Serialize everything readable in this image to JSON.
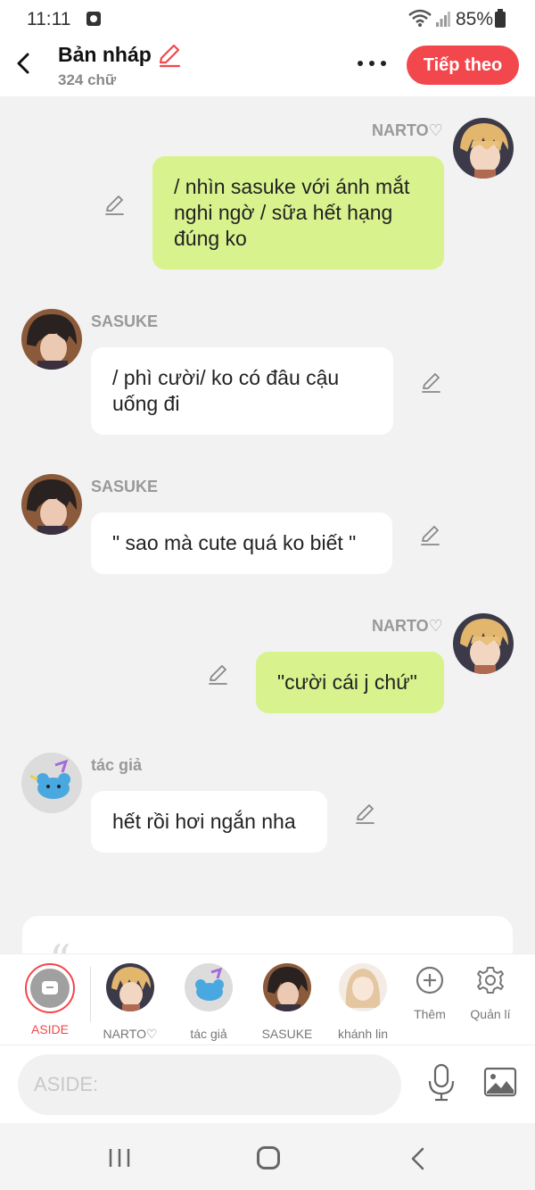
{
  "status_bar": {
    "time": "11:11",
    "battery": "85%"
  },
  "header": {
    "title": "Bản nháp",
    "word_count": "324 chữ",
    "next_label": "Tiếp theo"
  },
  "messages": [
    {
      "sender": "NARTO♡",
      "side": "right",
      "text": "/ nhìn sasuke với ánh mắt nghi ngờ / sữa hết hạng đúng ko"
    },
    {
      "sender": "SASUKE",
      "side": "left",
      "text": "/ phì cười/ ko có đâu cậu uống đi"
    },
    {
      "sender": "SASUKE",
      "side": "left",
      "text": "\" sao mà cute quá ko biết \""
    },
    {
      "sender": "NARTO♡",
      "side": "right",
      "text": "\"cười cái j chứ\""
    },
    {
      "sender": "tác giả",
      "side": "left",
      "text": "hết rồi hơi ngắn nha"
    }
  ],
  "characters": [
    {
      "label": "ASIDE",
      "active": true
    },
    {
      "label": "NARTO♡"
    },
    {
      "label": "tác giả"
    },
    {
      "label": "SASUKE"
    },
    {
      "label": "khánh lin"
    }
  ],
  "tools": {
    "add_label": "Thêm",
    "manage_label": "Quản lí"
  },
  "composer": {
    "placeholder": "ASIDE:"
  },
  "colors": {
    "accent": "#f2474c",
    "my_bubble": "#d8f38e",
    "their_bubble": "#ffffff"
  },
  "icons": [
    "back-arrow-icon",
    "pencil-icon",
    "more-icon",
    "microphone-icon",
    "image-icon",
    "plus-icon",
    "gear-icon"
  ]
}
